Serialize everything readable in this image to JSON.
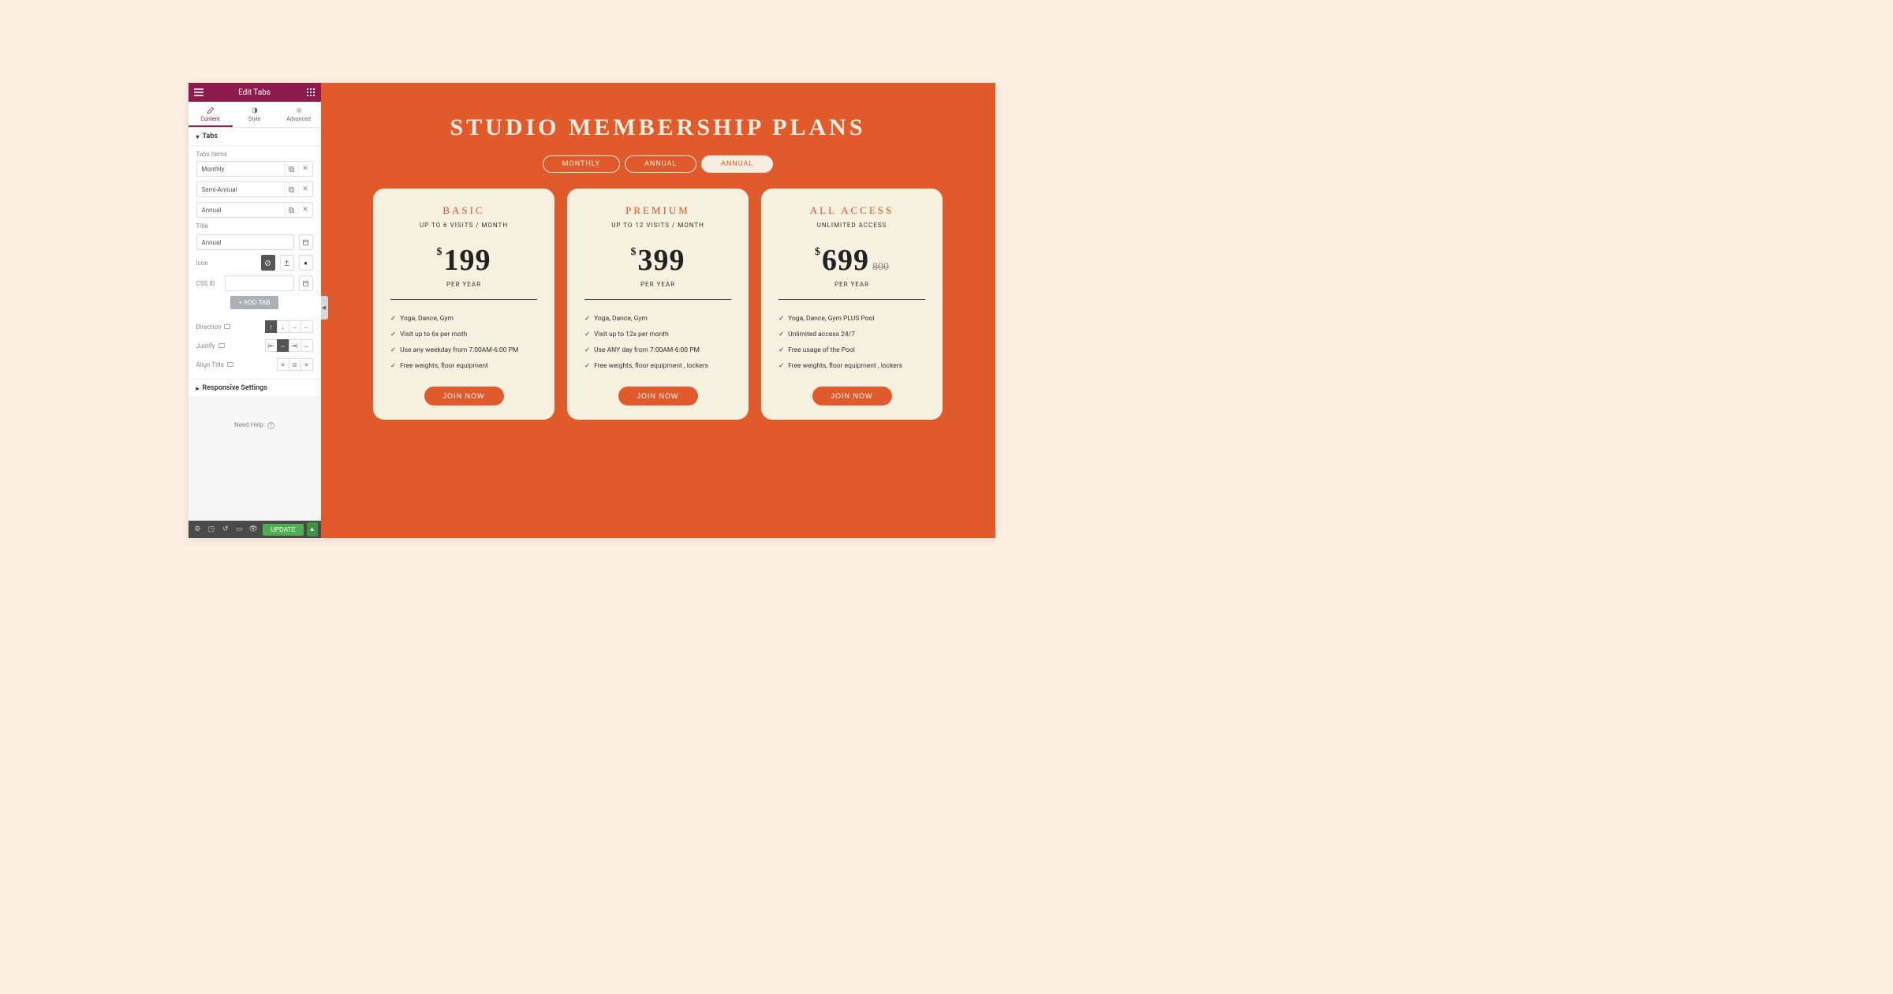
{
  "sidebar": {
    "header_title": "Edit Tabs",
    "panel_tabs": [
      {
        "label": "Content",
        "active": true
      },
      {
        "label": "Style",
        "active": false
      },
      {
        "label": "Advanced",
        "active": false
      }
    ],
    "section_tabs": {
      "title": "Tabs",
      "items_label": "Tabs Items",
      "items": [
        {
          "name": "Monthly"
        },
        {
          "name": "Semi-Annual"
        },
        {
          "name": "Annual"
        }
      ],
      "title_label": "Title",
      "title_value": "Annual",
      "icon_label": "Icon",
      "cssid_label": "CSS ID",
      "cssid_value": "",
      "add_tab_label": "+   ADD TAB"
    },
    "direction_label": "Direction",
    "justify_label": "Justify",
    "align_title_label": "Align Title",
    "responsive_section": "Responsive Settings",
    "need_help": "Need Help",
    "update_label": "UPDATE"
  },
  "preview": {
    "title": "STUDIO MEMBERSHIP PLANS",
    "tabs": [
      {
        "label": "MONTHLY",
        "active": false
      },
      {
        "label": "ANNUAL",
        "active": false
      },
      {
        "label": "ANNUAL",
        "active": true
      }
    ],
    "cards": [
      {
        "name": "BASIC",
        "sub": "UP TO 6 VISITS / MONTH",
        "currency": "$",
        "price": "199",
        "strike": "",
        "per": "PER YEAR",
        "features": [
          "Yoga, Dance, Gym",
          "Visit up to 6x per moth",
          "Use any weekday from 7:00AM-6:00 PM",
          "Free weights, floor equipment"
        ],
        "cta": "JOIN NOW"
      },
      {
        "name": "PREMIUM",
        "sub": "UP TO 12 VISITS / MONTH",
        "currency": "$",
        "price": "399",
        "strike": "",
        "per": "PER YEAR",
        "features": [
          "Yoga, Dance, Gym",
          "Visit up to 12x per month",
          "Use ANY day from 7:00AM-6:00 PM",
          "Free weights, floor equipment , lockers"
        ],
        "cta": "JOIN NOW"
      },
      {
        "name": "ALL ACCESS",
        "sub": "UNLIMITED ACCESS",
        "currency": "$",
        "price": "699",
        "strike": "800",
        "per": "PER YEAR",
        "features": [
          "Yoga, Dance, Gym PLUS Pool",
          "Unlimited access 24/7",
          "Free usage of the Pool",
          "Free weights, floor equipment , lockers"
        ],
        "cta": "JOIN NOW"
      }
    ]
  }
}
